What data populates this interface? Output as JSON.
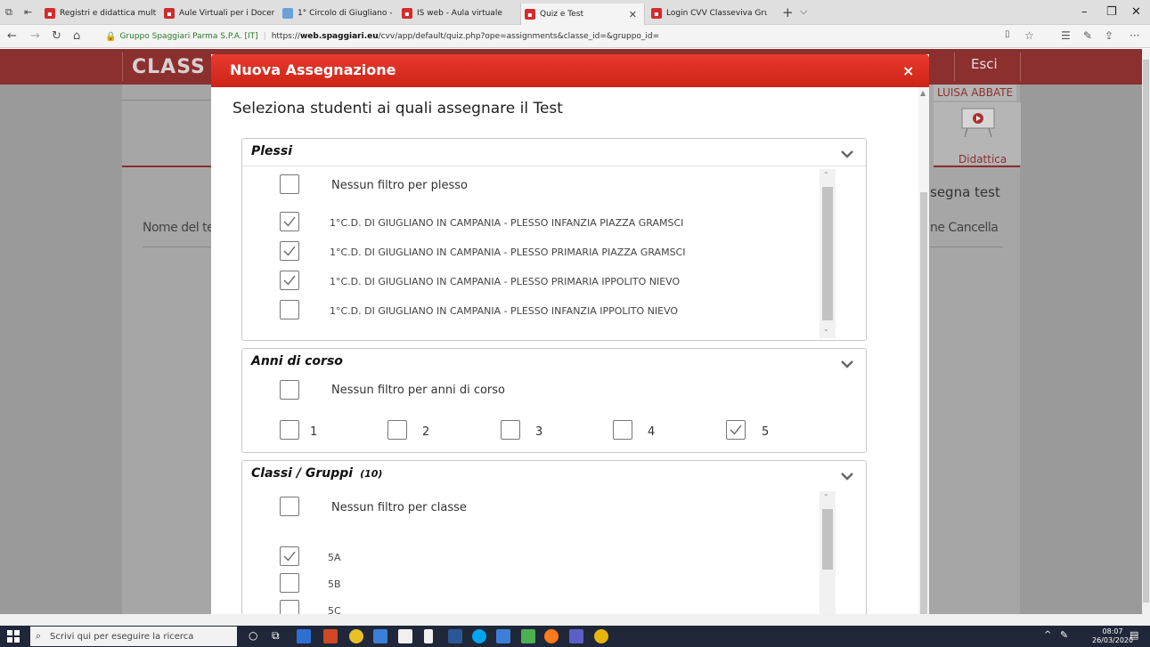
{
  "browser": {
    "tabs": [
      {
        "label": "Registri e didattica multime",
        "icon": "classeviva-icon"
      },
      {
        "label": "Aule Virtuali per i Docenti.p",
        "icon": "document-icon"
      },
      {
        "label": "1° Circolo di Giugliano - Avv",
        "icon": "site-icon"
      },
      {
        "label": "IS web - Aula virtuale",
        "icon": "classeviva-icon"
      },
      {
        "label": "Quiz e Test",
        "icon": "classeviva-icon"
      },
      {
        "label": "Login CVV Classeviva Grupp",
        "icon": "classeviva-icon"
      }
    ],
    "active_tab_index": 4,
    "site_identity": "Gruppo Spaggiari Parma S.P.A. [IT]",
    "url_prefix": "https://",
    "url_domain": "web.spaggiari.eu",
    "url_path": "/cvv/app/default/quiz.php?ope=assignments&classe_id=&gruppo_id="
  },
  "page": {
    "logo": "CLASS",
    "logout": "Esci",
    "user": "LUISA ABBATE",
    "nav_didattica": "Didattica",
    "assign_button": "segna test",
    "col_name": "Nome del te",
    "col_right": "ne  Cancella"
  },
  "modal": {
    "title": "Nuova Assegnazione",
    "close": "×",
    "subtitle": "Seleziona studenti ai quali assegnare il Test",
    "plessi": {
      "title": "Plessi",
      "no_filter": "Nessun filtro per plesso",
      "no_filter_checked": false,
      "items": [
        {
          "label": "1°C.D. DI GIUGLIANO IN CAMPANIA - PLESSO INFANZIA PIAZZA GRAMSCI",
          "checked": true
        },
        {
          "label": "1°C.D. DI GIUGLIANO IN CAMPANIA - PLESSO PRIMARIA PIAZZA GRAMSCI",
          "checked": true
        },
        {
          "label": "1°C.D. DI GIUGLIANO IN CAMPANIA - PLESSO PRIMARIA IPPOLITO NIEVO",
          "checked": true
        },
        {
          "label": "1°C.D. DI GIUGLIANO IN CAMPANIA - PLESSO INFANZIA IPPOLITO NIEVO",
          "checked": false
        }
      ]
    },
    "anni": {
      "title": "Anni di corso",
      "no_filter": "Nessun filtro per anni di corso",
      "no_filter_checked": false,
      "items": [
        {
          "label": "1",
          "checked": false
        },
        {
          "label": "2",
          "checked": false
        },
        {
          "label": "3",
          "checked": false
        },
        {
          "label": "4",
          "checked": false
        },
        {
          "label": "5",
          "checked": true
        }
      ]
    },
    "classi": {
      "title": "Classi / Gruppi",
      "count": "(10)",
      "no_filter": "Nessun filtro per classe",
      "no_filter_checked": false,
      "items": [
        {
          "label": "5A",
          "checked": true
        },
        {
          "label": "5B",
          "checked": false
        },
        {
          "label": "5C",
          "checked": false
        }
      ]
    }
  },
  "taskbar": {
    "search_placeholder": "Scrivi qui per eseguire la ricerca",
    "time": "08:07",
    "date": "26/03/2020"
  }
}
